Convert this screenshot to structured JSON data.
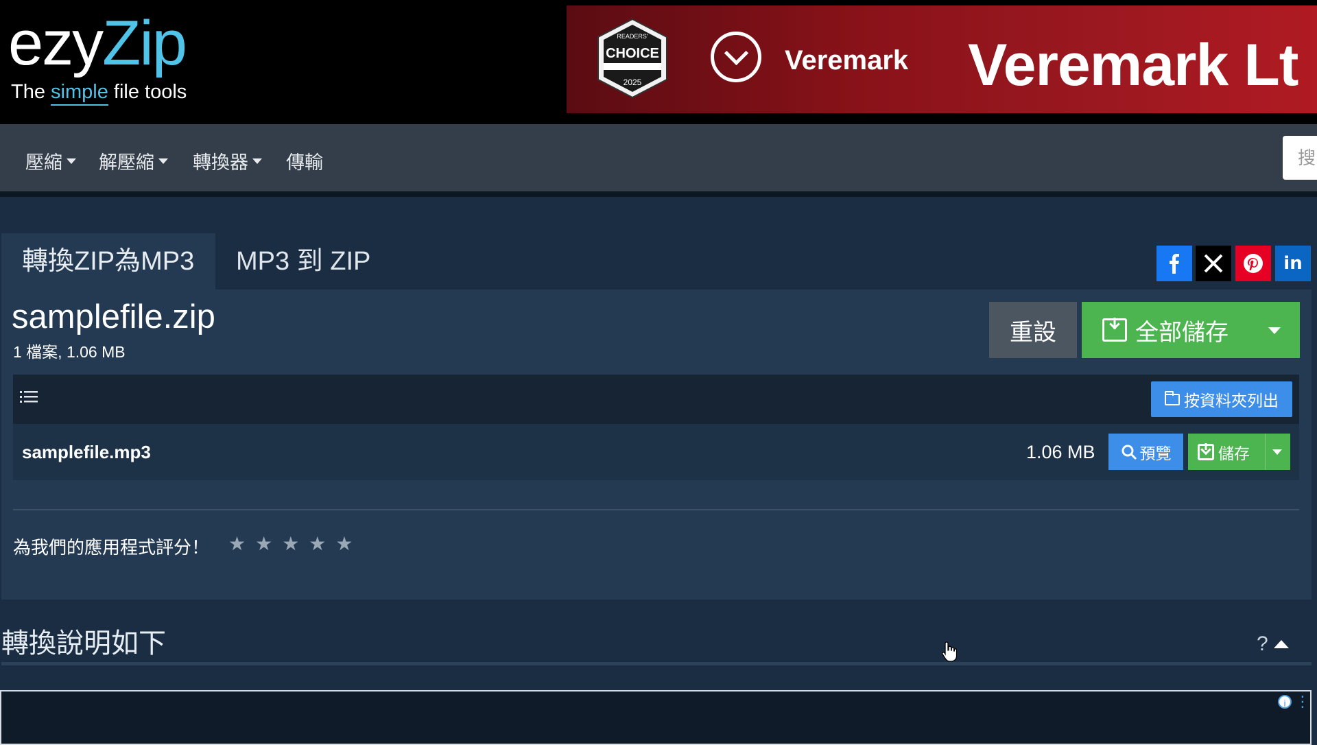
{
  "header": {
    "logo_main_a": "ezy",
    "logo_main_b": "Zip",
    "logo_tag_a": "The ",
    "logo_tag_b": "simple",
    "logo_tag_c": " file tools"
  },
  "ad_banner": {
    "badge_text": "CHOICE",
    "badge_year": "2025",
    "badge_top": "READERS'",
    "brand_small": "Veremark",
    "brand_big": "Veremark Lt"
  },
  "nav": {
    "items": [
      {
        "label": "壓縮",
        "has_caret": true
      },
      {
        "label": "解壓縮",
        "has_caret": true
      },
      {
        "label": "轉換器",
        "has_caret": true
      },
      {
        "label": "傳輸",
        "has_caret": false
      }
    ],
    "search_placeholder": "搜"
  },
  "tabs": [
    {
      "label": "轉換ZIP為MP3",
      "active": true
    },
    {
      "label": "MP3 到 ZIP",
      "active": false
    }
  ],
  "social": [
    {
      "name": "facebook",
      "glyph": "f",
      "color": "#1877f2"
    },
    {
      "name": "x",
      "glyph": "X",
      "color": "#000000"
    },
    {
      "name": "pinterest",
      "glyph": "P",
      "color": "#e60023"
    },
    {
      "name": "linkedin",
      "glyph": "in",
      "color": "#0a66c2"
    }
  ],
  "file": {
    "title": "samplefile.zip",
    "meta": "1 檔案, 1.06 MB"
  },
  "actions": {
    "reset_label": "重設",
    "save_all_label": "全部儲存"
  },
  "list": {
    "folder_button_label": "按資料夾列出",
    "rows": [
      {
        "name": "samplefile.mp3",
        "size": "1.06 MB",
        "preview_label": "預覽",
        "save_label": "儲存"
      }
    ]
  },
  "rating": {
    "label": "為我們的應用程式評分！",
    "stars": "★★★★★",
    "value": 0,
    "max": 5
  },
  "help": {
    "title": "轉換說明如下",
    "toggle_label": "?"
  },
  "colors": {
    "accent_green": "#4cb550",
    "accent_blue": "#3d8ee8",
    "bg": "#1a2d42",
    "panel": "#243a52",
    "logo_cyan": "#4fc3e8"
  }
}
